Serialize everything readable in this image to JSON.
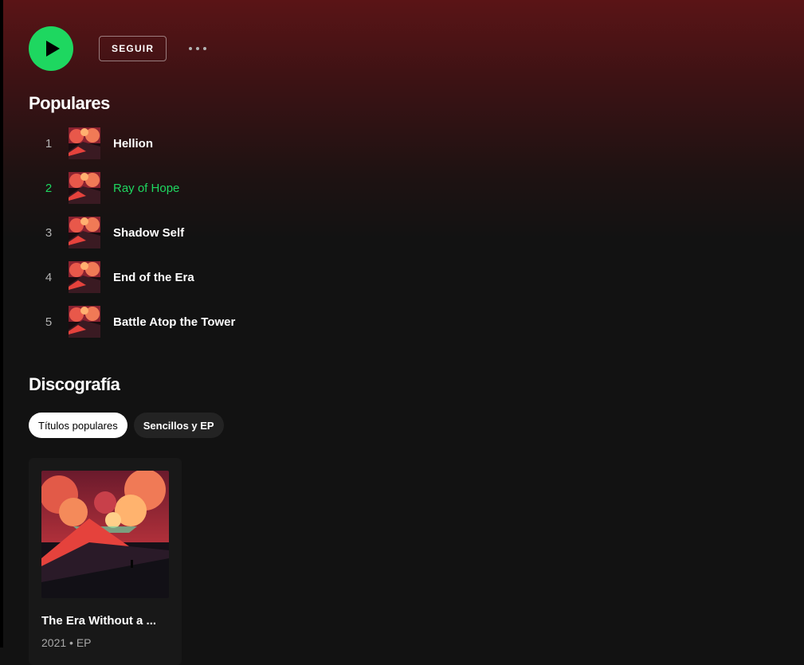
{
  "actions": {
    "follow_label": "SEGUIR"
  },
  "popular": {
    "title": "Populares",
    "tracks": [
      {
        "number": "1",
        "name": "Hellion"
      },
      {
        "number": "2",
        "name": "Ray of Hope"
      },
      {
        "number": "3",
        "name": "Shadow Self"
      },
      {
        "number": "4",
        "name": "End of the Era"
      },
      {
        "number": "5",
        "name": "Battle Atop the Tower"
      }
    ]
  },
  "discography": {
    "title": "Discografía",
    "filters": [
      "Títulos populares",
      "Sencillos y EP"
    ],
    "albums": [
      {
        "title": "The Era Without a ...",
        "year": "2021",
        "type": "EP"
      }
    ]
  },
  "colors": {
    "accent": "#1ed760",
    "header_gradient_top": "#5a1416",
    "background": "#121212"
  }
}
